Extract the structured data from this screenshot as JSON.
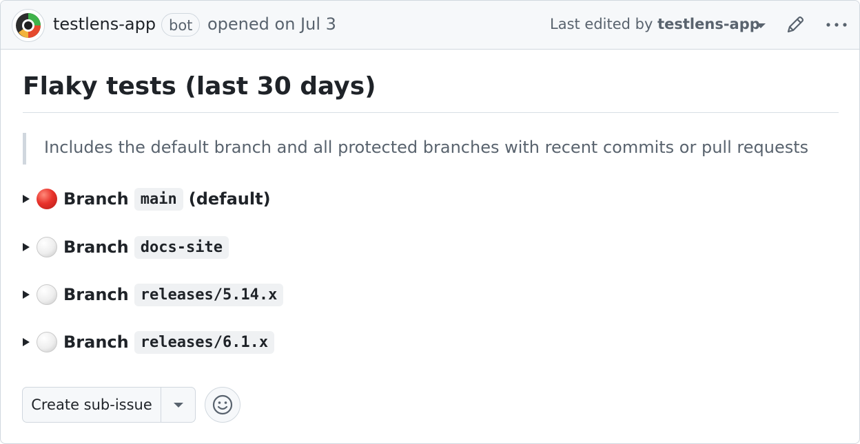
{
  "header": {
    "author": "testlens-app",
    "badge": "bot",
    "opened": "opened on Jul 3",
    "edited_prefix": "Last edited by",
    "edited_by": "testlens-app"
  },
  "issue": {
    "title": "Flaky tests (last 30 days)",
    "quote": "Includes the default branch and all protected branches with recent commits or pull requests"
  },
  "branches": [
    {
      "status": "red-circle",
      "label": "Branch",
      "name": "main",
      "suffix": "(default)"
    },
    {
      "status": "white-circle",
      "label": "Branch",
      "name": "docs-site",
      "suffix": ""
    },
    {
      "status": "white-circle",
      "label": "Branch",
      "name": "releases/5.14.x",
      "suffix": ""
    },
    {
      "status": "white-circle",
      "label": "Branch",
      "name": "releases/6.1.x",
      "suffix": ""
    }
  ],
  "actions": {
    "create_sub_issue": "Create sub-issue"
  },
  "colors": {
    "header_bg": "#f6f8fa",
    "muted": "#59636e",
    "status_red": "#e8322b"
  },
  "icons": [
    "avatar-logo",
    "chevron-down-icon",
    "pencil-icon",
    "kebab-menu-icon",
    "smiley-icon"
  ]
}
